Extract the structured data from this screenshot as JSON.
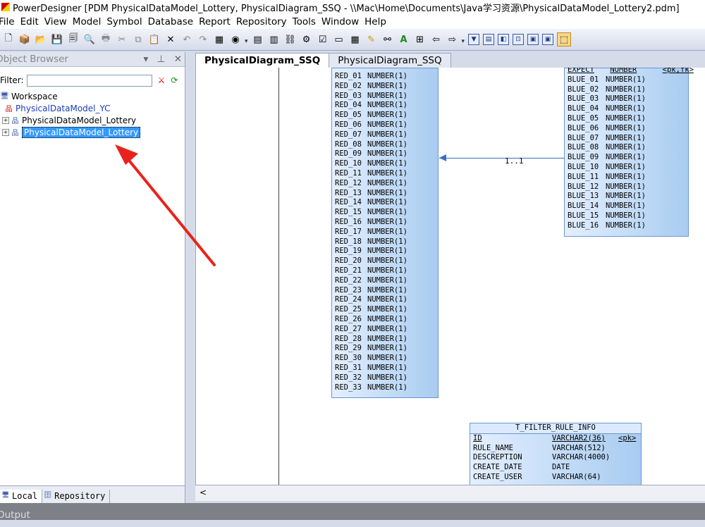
{
  "window": {
    "title": "PowerDesigner [PDM PhysicalDataModel_Lottery, PhysicalDiagram_SSQ - \\\\Mac\\Home\\Documents\\Java学习资源\\PhysicalDataModel_Lottery2.pdm]"
  },
  "menu": [
    "File",
    "Edit",
    "View",
    "Model",
    "Symbol",
    "Database",
    "Report",
    "Repository",
    "Tools",
    "Window",
    "Help"
  ],
  "browser": {
    "title": "Object Browser",
    "filter_label": "Filter:",
    "filter_value": "",
    "workspace": "Workspace",
    "models": [
      "PhysicalDataModel_YC",
      "PhysicalDataModel_Lottery",
      "PhysicalDataModel_Lottery"
    ],
    "tabs": [
      "Local",
      "Repository"
    ]
  },
  "diagram_tabs": [
    "PhysicalDiagram_SSQ",
    "PhysicalDiagram_SSQ"
  ],
  "red_table": {
    "type": "NUMBER(1)",
    "columns": [
      "RED_01",
      "RED_02",
      "RED_03",
      "RED_04",
      "RED_05",
      "RED_06",
      "RED_07",
      "RED_08",
      "RED_09",
      "RED_10",
      "RED_11",
      "RED_12",
      "RED_13",
      "RED_14",
      "RED_15",
      "RED_16",
      "RED_17",
      "RED_18",
      "RED_19",
      "RED_20",
      "RED_21",
      "RED_22",
      "RED_23",
      "RED_24",
      "RED_25",
      "RED_26",
      "RED_27",
      "RED_28",
      "RED_29",
      "RED_30",
      "RED_31",
      "RED_32",
      "RED_33"
    ]
  },
  "blue_table": {
    "first_row": {
      "name": "EXPECT",
      "type": "NUMBER",
      "key": "<pk,fk>"
    },
    "type": "NUMBER(1)",
    "columns": [
      "BLUE_01",
      "BLUE_02",
      "BLUE_03",
      "BLUE_04",
      "BLUE_05",
      "BLUE_06",
      "BLUE_07",
      "BLUE_08",
      "BLUE_09",
      "BLUE_10",
      "BLUE_11",
      "BLUE_12",
      "BLUE_13",
      "BLUE_14",
      "BLUE_15",
      "BLUE_16"
    ]
  },
  "relationship_label": "1..1",
  "filter_table": {
    "name": "T_FILTER_RULE_INFO",
    "rows": [
      {
        "name": "ID",
        "type": "VARCHAR2(36)",
        "key": "<pk>"
      },
      {
        "name": "RULE_NAME",
        "type": "VARCHAR(512)",
        "key": ""
      },
      {
        "name": "DESCREPTION",
        "type": "VARCHAR(4000)",
        "key": ""
      },
      {
        "name": "CREATE_DATE",
        "type": "DATE",
        "key": ""
      },
      {
        "name": "CREATE_USER",
        "type": "VARCHAR(64)",
        "key": ""
      }
    ]
  },
  "output_label": "Output",
  "colors": {
    "annotation_arrow": "#e8231d",
    "selection": "#3399ff",
    "table_gradient_end": "#a8ccf0"
  }
}
